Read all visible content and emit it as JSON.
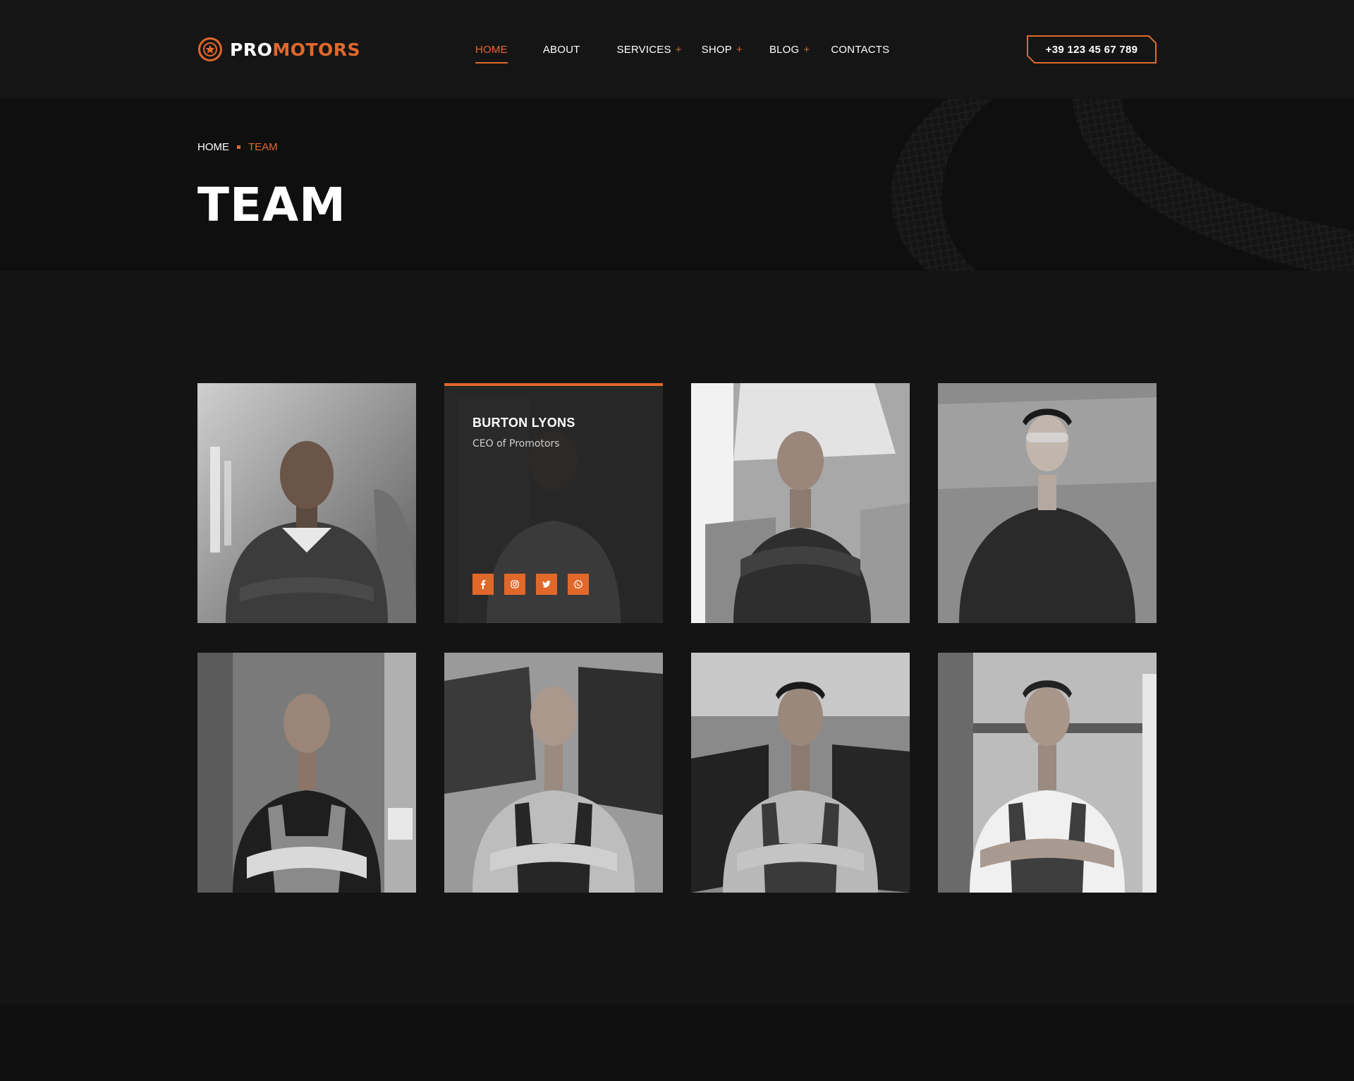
{
  "header": {
    "logo": {
      "pro": "PRO",
      "motors": "MOTORS",
      "icon": "wheel-logo-icon"
    },
    "nav": [
      {
        "label": "HOME",
        "active": true,
        "has_submenu": false
      },
      {
        "label": "ABOUT",
        "active": false,
        "has_submenu": false
      },
      {
        "label": "SERVICES",
        "active": false,
        "has_submenu": true
      },
      {
        "label": "SHOP",
        "active": false,
        "has_submenu": true
      },
      {
        "label": "BLOG",
        "active": false,
        "has_submenu": true
      },
      {
        "label": "CONTACTS",
        "active": false,
        "has_submenu": false
      }
    ],
    "submenu_symbol": "+",
    "phone": "+39 123 45 67 789"
  },
  "breadcrumb": {
    "home": "HOME",
    "current": "TEAM"
  },
  "page_title": "TEAM",
  "team": {
    "featured": {
      "name": "BURTON LYONS",
      "role": "CEO of Promotors",
      "socials": [
        "facebook-icon",
        "instagram-icon",
        "twitter-icon",
        "whatsapp-icon"
      ]
    }
  },
  "colors": {
    "accent": "#e0682b",
    "background": "#141414",
    "band": "#0f0f0f",
    "header": "#151515"
  }
}
